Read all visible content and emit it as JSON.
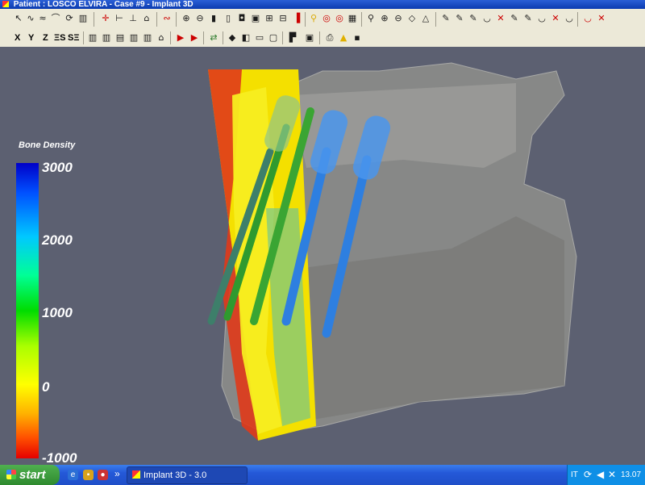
{
  "window": {
    "title": "Patient : LOSCO ELVIRA - Case #9 - Implant 3D"
  },
  "toolbar_row2": {
    "axis_buttons": [
      "X",
      "Y",
      "Z",
      "ΞS",
      "SΞ"
    ]
  },
  "legend": {
    "title": "Bone Density",
    "ticks": [
      "3000",
      "2000",
      "1000",
      "0",
      "-1000"
    ]
  },
  "taskbar": {
    "start_label": "start",
    "overflow_label": "»",
    "task_label": "Implant 3D - 3.0",
    "language": "IT",
    "clock": "13.07"
  },
  "colors": {
    "scan_gray": "#8d8d8a",
    "implant_blue": "#2e7fe0",
    "implant_green": "#3aa533",
    "implant_teal": "#3d7f6a",
    "viewport_bg": "#5c6071"
  }
}
